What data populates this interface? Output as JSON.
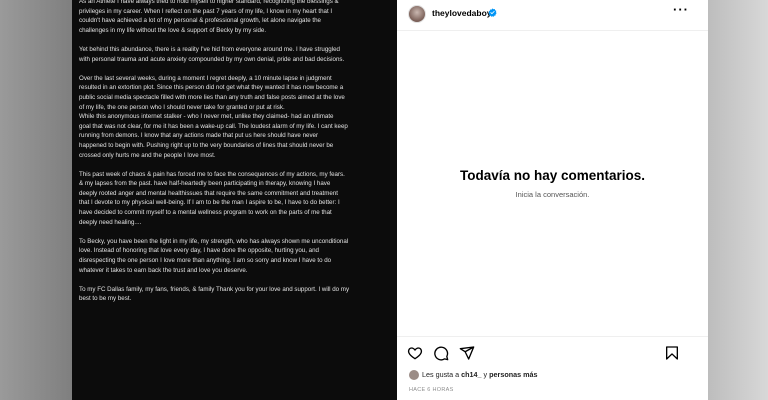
{
  "post": {
    "letter_text": "As an Athlete I have always tried to hold myself to higher standard, recognizing the blessings &\nprivileges in my career. When I reflect on the past 7 years of my life, I know in my heart that I\ncouldn't have achieved a lot of my personal & professional growth, let alone navigate the\nchallenges in my life without the love & support of Becky by my side.\n\nYet behind this abundance, there is a reality I've hid from everyone around me. I have struggled\nwith personal trauma and acute anxiety compounded by my own denial, pride and bad decisions.\n\nOver the last several weeks, during a moment I regret deeply, a 10 minute lapse in judgment\nresulted in an extortion plot. Since this person did not get what they wanted it has now become a\npublic social media spectacle filled with more lies than any truth and false posts aimed at the love\nof my life, the one person who I should never take for granted or put at risk.\nWhile this anonymous internet stalker - who I never met, unlike they claimed- had an ultimate\ngoal that was not clear, for me it has been a wake-up call. The loudest alarm of my life. I cant keep\nrunning from demons. I know that any actions made that put us here should have never\nhappened to begin with. Pushing right up to the very boundaries of lines that should never be\ncrossed only hurts me and the people I love most.\n\nThis past week of chaos & pain has forced me to face the consequences of my actions, my fears.\n& my lapses from the past. have half-heartedly been participating in therapy, knowing I have\ndeeply rooted anger and mental healthissues that require the same commitment and treatment\nthat I devote to my physical well-being. If I am to be the man I aspire to be, I have to do better: I\nhave decided to commit myself to a mental wellness program to work on the parts of me that\ndeeply need healing....\n\nTo Becky, you have been the light in my life, my strength, who has always shown me unconditional\nlove. Instead of honoring that love every day, I have done the opposite, hurting you, and\ndisrespecting the one person I love more than anything. I am so sorry and know I have to do\nwhatever it takes to earn back the trust and love you deserve.\n\nTo my FC Dallas family, my fans, friends, & family Thank you for your love and support. I will do my\nbest to be my best."
  },
  "header": {
    "username": "theylovedaboy"
  },
  "comments": {
    "empty_title": "Todavía no hay comentarios.",
    "empty_subtitle": "Inicia la conversación."
  },
  "likes": {
    "prefix": "Les gusta a ",
    "user": "ch14_",
    "middle": " y ",
    "others": "personas más"
  },
  "timestamp": "HACE 6 HORAS",
  "icons": {
    "like": "heart-icon",
    "comment": "comment-icon",
    "share": "send-icon",
    "save": "bookmark-icon",
    "options": "more-options-icon",
    "verified": "verified-badge-icon"
  },
  "colors": {
    "verified_blue": "#0095f6",
    "post_background": "#0c0c0c",
    "panel_background": "#ffffff"
  }
}
